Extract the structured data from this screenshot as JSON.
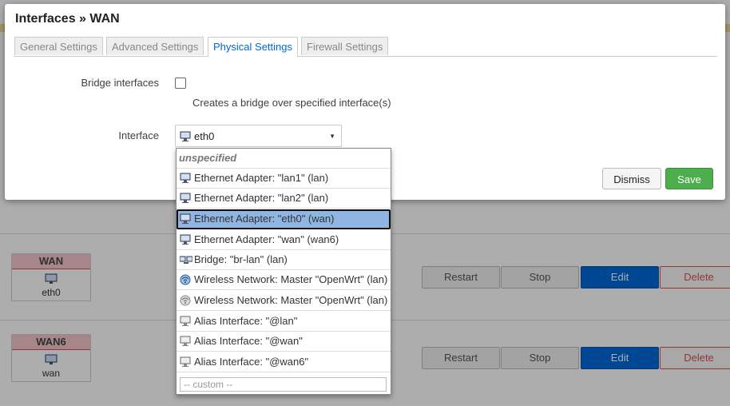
{
  "modal": {
    "title": "Interfaces » WAN",
    "tabs": [
      {
        "label": "General Settings"
      },
      {
        "label": "Advanced Settings"
      },
      {
        "label": "Physical Settings",
        "active": true
      },
      {
        "label": "Firewall Settings"
      }
    ],
    "bridge": {
      "label": "Bridge interfaces",
      "description": "Creates a bridge over specified interface(s)"
    },
    "interface": {
      "label": "Interface",
      "value": "eth0"
    },
    "dismiss_label": "Dismiss",
    "save_label": "Save"
  },
  "dropdown": {
    "items": [
      {
        "text": "unspecified",
        "icon": "none"
      },
      {
        "text": "Ethernet Adapter: \"lan1\" (lan)",
        "icon": "ethernet-icon"
      },
      {
        "text": "Ethernet Adapter: \"lan2\" (lan)",
        "icon": "ethernet-icon"
      },
      {
        "text": "Ethernet Adapter: \"eth0\" (wan)",
        "icon": "ethernet-icon",
        "selected": true
      },
      {
        "text": "Ethernet Adapter: \"wan\" (wan6)",
        "icon": "ethernet-icon"
      },
      {
        "text": "Bridge: \"br-lan\" (lan)",
        "icon": "bridge-icon"
      },
      {
        "text": "Wireless Network: Master \"OpenWrt\" (lan)",
        "icon": "wifi-icon"
      },
      {
        "text": "Wireless Network: Master \"OpenWrt\" (lan)",
        "icon": "wifi-icon"
      },
      {
        "text": "Alias Interface: \"@lan\"",
        "icon": "alias-icon"
      },
      {
        "text": "Alias Interface: \"@wan\"",
        "icon": "alias-icon"
      },
      {
        "text": "Alias Interface: \"@wan6\"",
        "icon": "alias-icon"
      }
    ],
    "custom_placeholder": "-- custom --"
  },
  "background": {
    "interfaces": [
      {
        "name": "WAN",
        "device": "eth0"
      },
      {
        "name": "WAN6",
        "device": "wan"
      }
    ],
    "buttons": {
      "restart": "Restart",
      "stop": "Stop",
      "edit": "Edit",
      "delete": "Delete"
    }
  },
  "colors": {
    "accent": "#0069d9",
    "save": "#4cae4c",
    "danger": "#d9534f",
    "selected": "#8fb5e3"
  }
}
